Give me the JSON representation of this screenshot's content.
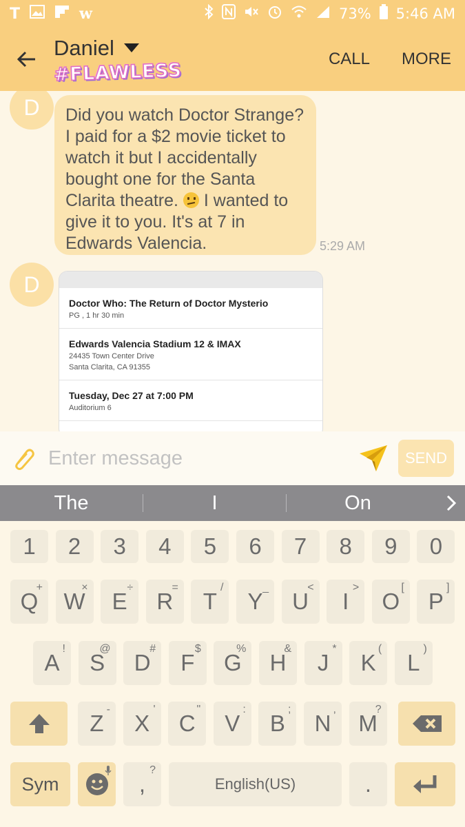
{
  "status_bar": {
    "left_icons": [
      "tmobile-icon",
      "image-icon",
      "flipboard-icon",
      "w-icon"
    ],
    "battery_percent": "73%",
    "time": "5:46 AM"
  },
  "header": {
    "contact_name": "Daniel",
    "sticker_text": "#FLAWLESS",
    "call_label": "CALL",
    "more_label": "MORE"
  },
  "conversation": {
    "avatar_letter": "D",
    "message_part1": "Did you watch Doctor Strange? I paid for a $2 movie ticket to watch it but I accidentally bought one for the Santa Clarita theatre.",
    "message_part2": "I wanted to give it to you. It's at 7 in Edwards Valencia.",
    "message_time": "5:29 AM",
    "ticket": {
      "movie_title": "Doctor Who: The Return of Doctor Mysterio",
      "movie_info": "PG , 1 hr 30 min",
      "theatre_name": "Edwards Valencia Stadium 12 & IMAX",
      "theatre_address1": "24435 Town Center Drive",
      "theatre_address2": "Santa Clarita,  CA  91355",
      "showtime": "Tuesday, Dec 27 at 7:00 PM",
      "auditorium": "Auditorium 6"
    }
  },
  "compose": {
    "placeholder": "Enter message",
    "send_label": "SEND"
  },
  "suggestions": [
    "The",
    "I",
    "On"
  ],
  "keyboard": {
    "numbers": [
      "1",
      "2",
      "3",
      "4",
      "5",
      "6",
      "7",
      "8",
      "9",
      "0"
    ],
    "row_q": [
      {
        "key": "Q",
        "alt": "+"
      },
      {
        "key": "W",
        "alt": "×"
      },
      {
        "key": "E",
        "alt": "÷"
      },
      {
        "key": "R",
        "alt": "="
      },
      {
        "key": "T",
        "alt": "/"
      },
      {
        "key": "Y",
        "alt": "_"
      },
      {
        "key": "U",
        "alt": "<"
      },
      {
        "key": "I",
        "alt": ">"
      },
      {
        "key": "O",
        "alt": "["
      },
      {
        "key": "P",
        "alt": "]"
      }
    ],
    "row_a": [
      {
        "key": "A",
        "alt": "!"
      },
      {
        "key": "S",
        "alt": "@"
      },
      {
        "key": "D",
        "alt": "#"
      },
      {
        "key": "F",
        "alt": "$"
      },
      {
        "key": "G",
        "alt": "%"
      },
      {
        "key": "H",
        "alt": "&"
      },
      {
        "key": "J",
        "alt": "*"
      },
      {
        "key": "K",
        "alt": "("
      },
      {
        "key": "L",
        "alt": ")"
      }
    ],
    "row_z": [
      {
        "key": "Z",
        "alt": "-"
      },
      {
        "key": "X",
        "alt": "'"
      },
      {
        "key": "C",
        "alt": "\""
      },
      {
        "key": "V",
        "alt": ":"
      },
      {
        "key": "B",
        "alt": ";"
      },
      {
        "key": "N",
        "alt": ","
      },
      {
        "key": "M",
        "alt": "?"
      }
    ],
    "sym_label": "Sym",
    "comma_key": ",",
    "comma_alt": "?",
    "space_label": "English(US)",
    "period_key": "."
  }
}
